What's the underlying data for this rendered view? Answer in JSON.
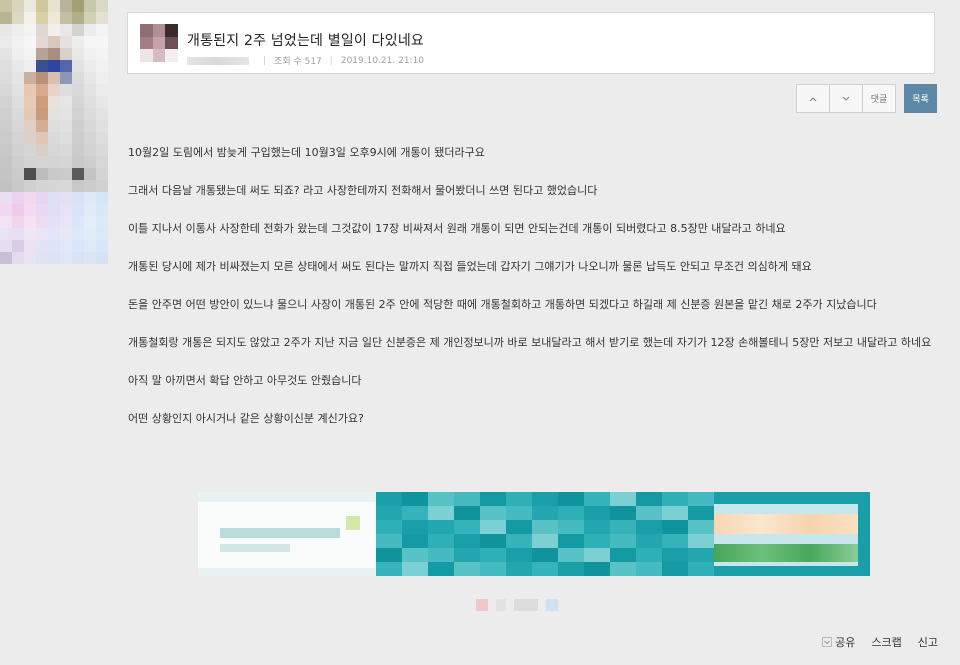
{
  "post": {
    "title": "개통된지 2주 넘었는데 별일이 다있네요",
    "views_label": "조회 수 517",
    "date": "2019.10.21. 21:10"
  },
  "toolbar": {
    "upvote_icon": "chevron-up-icon",
    "downvote_icon": "chevron-down-icon",
    "comment_label": "댓글",
    "list_label": "목록"
  },
  "body": {
    "paragraphs": [
      "10월2일 도림에서 밤늦게 구입했는데 10월3일 오후9시에 개통이 됐더라구요",
      "그래서 다음날 개통됐는데 써도 되죠? 라고 사장한테까지 전화해서 물어봤더니 쓰면 된다고 했었습니다",
      "이틀 지나서 이통사 사장한테 전화가 왔는데 그것값이 17장 비싸져서 원래 개통이 되면 안되는건데 개통이 되버렸다고 8.5장만 내달라고 하네요",
      "개통된 당시에 제가 비싸졌는지 모른 상태에서 써도 된다는 말까지 직접 들었는데 갑자기 그얘기가 나오니까 물론 납득도 안되고 무조건 의심하게 돼요",
      "돈을 안주면 어떤 방안이 있느냐 물으니 사장이 개통된 2주 안에 적당한 때에 개통철회하고 개통하면 되겠다고 하길래 제 신분증 원본을 맡긴 채로 2주가 지났습니다",
      "개통철회랑 개통은 되지도 않았고 2주가 지난 지금 일단 신분증은 제 개인정보니까 바로 보내달라고 해서 받기로 했는데 자기가 12장 손해볼테니 5장만 저보고 내달라고 하네요",
      "아직 말 아끼면서 확답 안하고 아무것도 안줬습니다",
      "어떤 상황인지 아시거나 같은 상황이신분 계신가요?"
    ]
  },
  "footer": {
    "share_label": "공유",
    "scrap_label": "스크랩",
    "report_label": "신고"
  },
  "colors": {
    "background": "#ececec",
    "list_button": "#5c87a6",
    "ad_teal": "#1a9fa8"
  }
}
